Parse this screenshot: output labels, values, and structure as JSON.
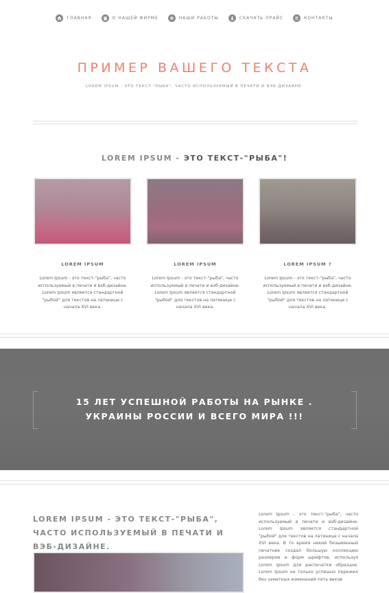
{
  "nav": {
    "items": [
      {
        "label": "главная",
        "icon": "home-icon"
      },
      {
        "label": "о нашей фирме",
        "icon": "building-icon"
      },
      {
        "label": "наши работы",
        "icon": "gear-icon"
      },
      {
        "label": "скачать прайс",
        "icon": "download-icon"
      },
      {
        "label": "контакты",
        "icon": "users-icon"
      }
    ]
  },
  "hero": {
    "title": "ПРИМЕР ВАШЕГО ТЕКСТА",
    "subtitle": "LOREM IPSUM - ЭТО ТЕКСТ-\"РЫБА\", ЧАСТО ИСПОЛЬЗУЕМЫЙ В ПЕЧАТИ И ВЭБ-ДИЗАЙНЕ."
  },
  "section": {
    "title_light": "LOREM IPSUM -",
    "title_bold": "ЭТО ТЕКСТ-\"РЫБА\"!"
  },
  "cards": [
    {
      "title": "LOREM IPSUM",
      "text": "Lorem Ipsum - это текст-\"рыба\", часто используемый в печати и вэб-дизайне. Lorem Ipsum является стандартной \"рыбой\" для текстов на латинице с начала XVI века."
    },
    {
      "title": "LOREM IPSUM",
      "text": "Lorem Ipsum - это текст-\"рыба\", часто используемый в печати и вэб-дизайне. Lorem Ipsum является стандартной \"рыбой\" для текстов на латинице с начала XVI века."
    },
    {
      "title": "LOREM IPSUM ?",
      "text": "Lorem Ipsum - это текст-\"рыба\", часто используемый в печати и вэб-дизайне. Lorem Ipsum является стандартной \"рыбой\" для текстов на латинице с начала XVI века."
    }
  ],
  "banner": {
    "line1": "15 ЛЕТ УСПЕШНОЙ РАБОТЫ НА РЫНКЕ .",
    "line2": "УКРАИНЫ РОССИИ И ВСЕГО МИРА !!!"
  },
  "bottom": {
    "title": "LOREM IPSUM - ЭТО ТЕКСТ-\"РЫБА\", ЧАСТО ИСПОЛЬЗУЕМЫЙ В ПЕЧАТИ И ВЭБ-ДИЗАЙНЕ.",
    "text": "Lorem Ipsum - это текст-\"рыба\", часто используемый в печати и вэб-дизайне. Lorem Ipsum является стандартной \"рыбой\" для текстов на латинице с начала XVI века. В то время некий безымянный печатник создал большую коллекцию размеров и форм шрифтов, используя Lorem Ipsum для распечатки образцов. Lorem Ipsum не только успешно пережил без заметных изменений пять веков"
  },
  "colors": {
    "accent": "#f0806a",
    "banner_bg": "#6f6f6f",
    "icon_bg": "#8a8a8a"
  }
}
